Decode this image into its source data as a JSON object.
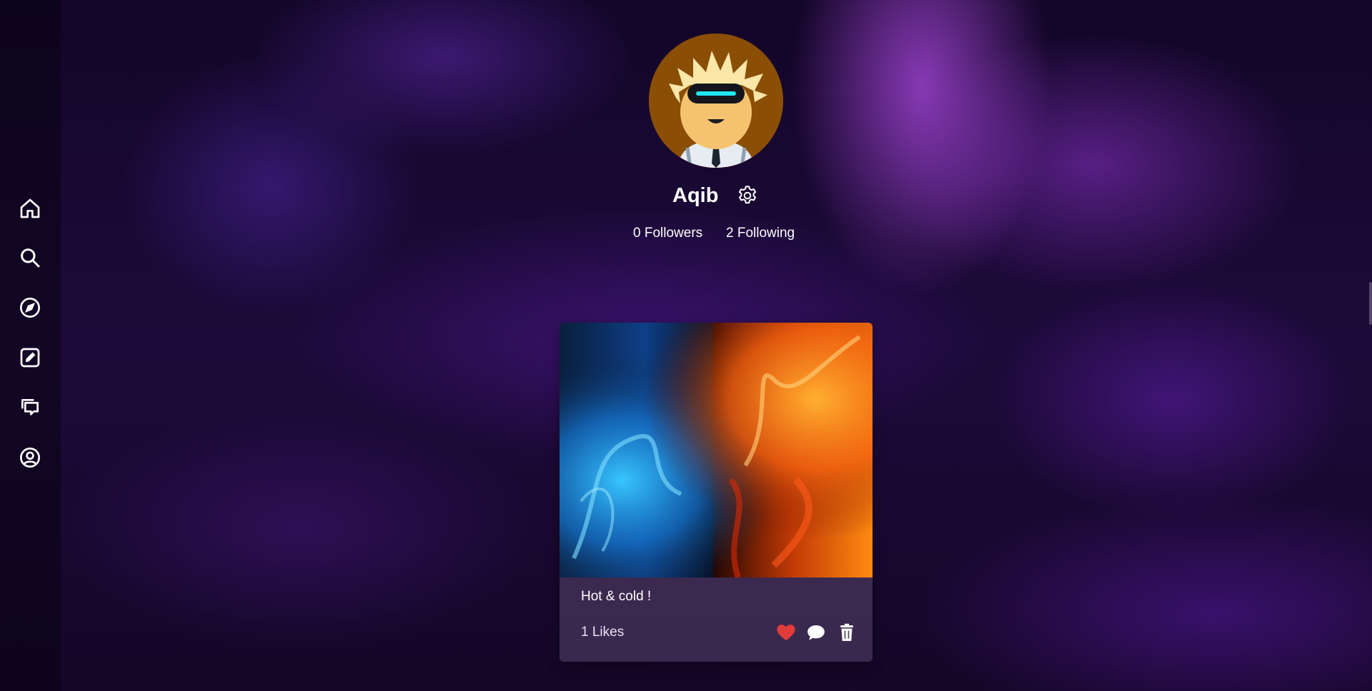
{
  "sidebar": {
    "items": [
      {
        "name": "home",
        "icon": "home-icon"
      },
      {
        "name": "search",
        "icon": "search-icon"
      },
      {
        "name": "explore",
        "icon": "compass-icon"
      },
      {
        "name": "create",
        "icon": "edit-icon"
      },
      {
        "name": "messages",
        "icon": "chat-icon"
      },
      {
        "name": "profile",
        "icon": "user-circle-icon"
      }
    ]
  },
  "profile": {
    "avatar_icon": "avatar-icon",
    "username": "Aqib",
    "settings_icon": "gear-icon",
    "followers_text": "0 Followers",
    "following_text": "2 Following"
  },
  "posts": [
    {
      "caption": "Hot & cold !",
      "likes_text": "1 Likes",
      "liked": true,
      "actions": [
        "heart-icon",
        "comment-icon",
        "trash-icon"
      ]
    }
  ],
  "colors": {
    "accent_like": "#e23b3b",
    "background_dark": "#150627",
    "card_bg": "#4d3e5e"
  }
}
